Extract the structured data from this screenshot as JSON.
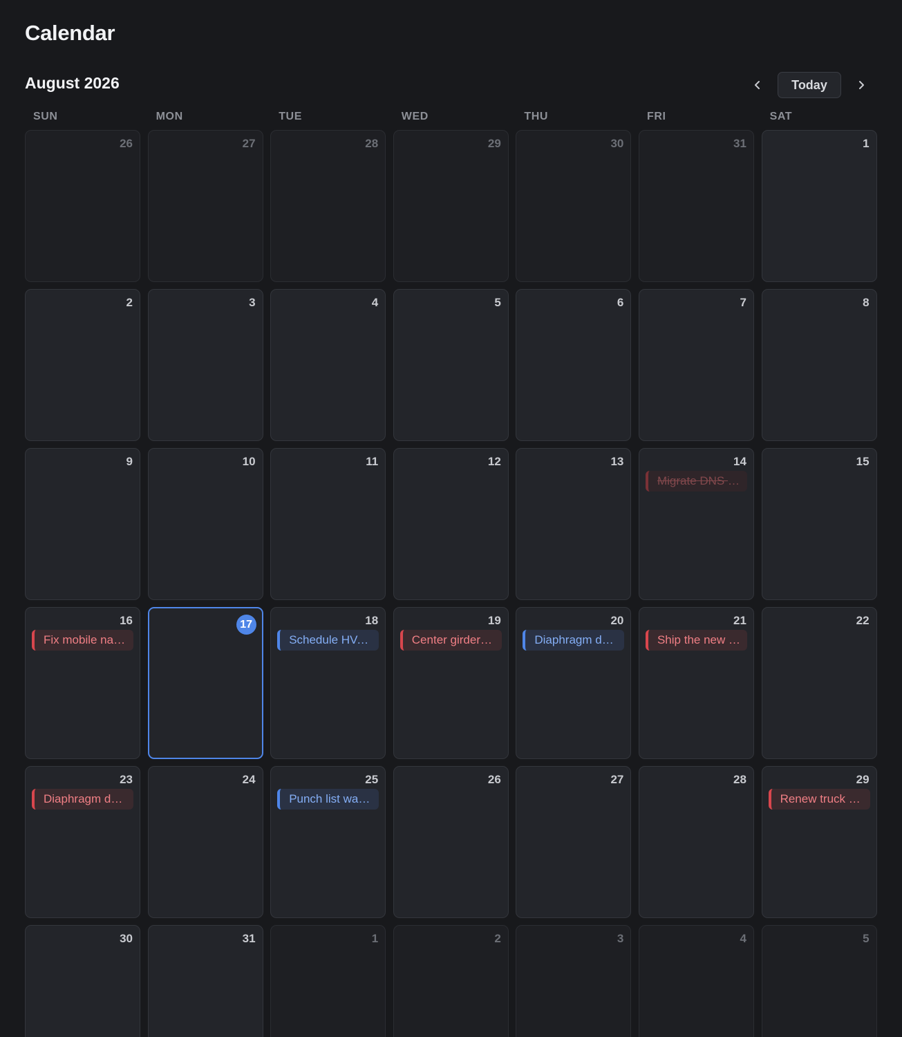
{
  "app": {
    "title": "Calendar"
  },
  "header": {
    "month_label": "August 2026",
    "today_label": "Today",
    "prev_icon": "chevron-left-icon",
    "next_icon": "chevron-right-icon"
  },
  "weekdays": [
    "SUN",
    "MON",
    "TUE",
    "WED",
    "THU",
    "FRI",
    "SAT"
  ],
  "colors": {
    "accent": "#4f86e8",
    "event_red": "#d8464d",
    "event_blue": "#4f86e8"
  },
  "days": [
    {
      "n": "26",
      "outside": true
    },
    {
      "n": "27",
      "outside": true
    },
    {
      "n": "28",
      "outside": true
    },
    {
      "n": "29",
      "outside": true
    },
    {
      "n": "30",
      "outside": true
    },
    {
      "n": "31",
      "outside": true
    },
    {
      "n": "1"
    },
    {
      "n": "2"
    },
    {
      "n": "3"
    },
    {
      "n": "4"
    },
    {
      "n": "5"
    },
    {
      "n": "6"
    },
    {
      "n": "7"
    },
    {
      "n": "8"
    },
    {
      "n": "9"
    },
    {
      "n": "10"
    },
    {
      "n": "11"
    },
    {
      "n": "12"
    },
    {
      "n": "13"
    },
    {
      "n": "14",
      "event": {
        "text": "Migrate DNS t…",
        "color": "red",
        "done": true
      }
    },
    {
      "n": "15"
    },
    {
      "n": "16",
      "event": {
        "text": "Fix mobile nav…",
        "color": "red"
      }
    },
    {
      "n": "17",
      "today": true
    },
    {
      "n": "18",
      "event": {
        "text": "Schedule HVA…",
        "color": "blue"
      }
    },
    {
      "n": "19",
      "event": {
        "text": "Center girder r…",
        "color": "red"
      }
    },
    {
      "n": "20",
      "event": {
        "text": "Diaphragm de…",
        "color": "blue"
      }
    },
    {
      "n": "21",
      "event": {
        "text": "Ship the new …",
        "color": "red"
      }
    },
    {
      "n": "22"
    },
    {
      "n": "23",
      "event": {
        "text": "Diaphragm de…",
        "color": "red"
      }
    },
    {
      "n": "24"
    },
    {
      "n": "25",
      "event": {
        "text": "Punch list wal…",
        "color": "blue"
      }
    },
    {
      "n": "26"
    },
    {
      "n": "27"
    },
    {
      "n": "28"
    },
    {
      "n": "29",
      "event": {
        "text": "Renew truck r…",
        "color": "red"
      }
    },
    {
      "n": "30"
    },
    {
      "n": "31"
    },
    {
      "n": "1",
      "outside": true
    },
    {
      "n": "2",
      "outside": true
    },
    {
      "n": "3",
      "outside": true
    },
    {
      "n": "4",
      "outside": true
    },
    {
      "n": "5",
      "outside": true
    }
  ]
}
